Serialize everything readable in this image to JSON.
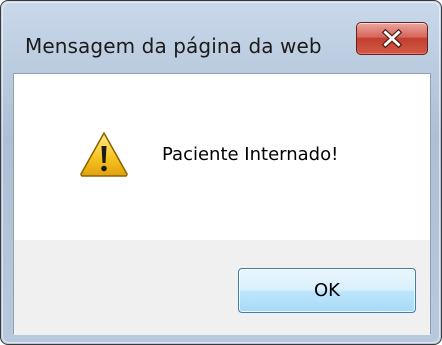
{
  "dialog": {
    "title": "Mensagem da página da web",
    "message": "Paciente Internado!",
    "ok_label": "OK",
    "close_icon": "close-icon",
    "message_icon": "warning-icon"
  },
  "colors": {
    "close_button": "#c94a3a",
    "ok_button_border": "#3c7fb1",
    "warning_fill": "#f7c623"
  }
}
